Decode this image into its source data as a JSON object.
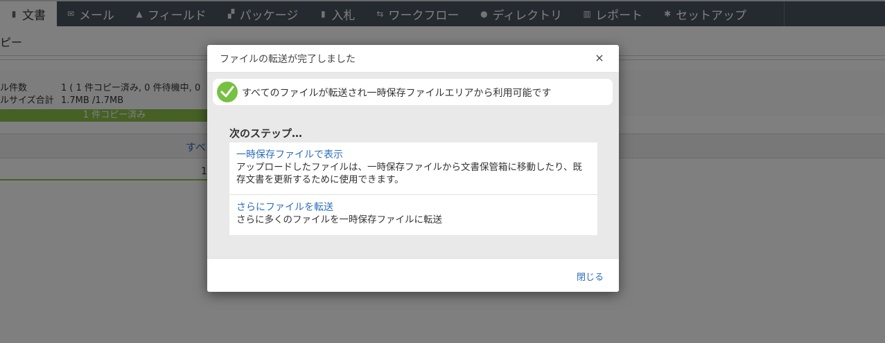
{
  "nav": {
    "items": [
      {
        "label": "文書",
        "icon": "document-icon",
        "glyph": "▮",
        "active": true
      },
      {
        "label": "メール",
        "icon": "envelope-icon",
        "glyph": "✉",
        "active": false
      },
      {
        "label": "フィールド",
        "icon": "warning-icon",
        "glyph": "▲",
        "active": false
      },
      {
        "label": "パッケージ",
        "icon": "package-icon",
        "glyph": "▞",
        "active": false
      },
      {
        "label": "入札",
        "icon": "file-icon",
        "glyph": "▮",
        "active": false
      },
      {
        "label": "ワークフロー",
        "icon": "workflow-icon",
        "glyph": "⇆",
        "active": false
      },
      {
        "label": "ディレクトリ",
        "icon": "users-icon",
        "glyph": "●",
        "active": false
      },
      {
        "label": "レポート",
        "icon": "bar-chart-icon",
        "glyph": "▥",
        "active": false
      },
      {
        "label": "セットアップ",
        "icon": "gear-icon",
        "glyph": "✱",
        "active": false
      }
    ]
  },
  "background": {
    "heading": "ピー",
    "file_count_label": "ル件数",
    "file_count_value": "1 ( 1 件コピー済み, 0 件待機中, 0",
    "file_size_label": "ルサイズ合計",
    "file_size_value": "1.7MB /1.7MB",
    "progress_text": "1 件コピー済み",
    "progress_value": 1.0,
    "tab_partial": "すべ",
    "page_number": "1"
  },
  "modal": {
    "title": "ファイルの転送が完了しました",
    "close_glyph": "×",
    "alert_text": "すべてのファイルが転送され一時保存ファイルエリアから利用可能です",
    "next_steps_title": "次のステップ…",
    "steps": [
      {
        "link": "一時保存ファイルで表示",
        "description": "アップロードしたファイルは、一時保存ファイルから文書保管箱に移動したり、既存文書を更新するために使用できます。"
      },
      {
        "link": "さらにファイルを転送",
        "description": "さらに多くのファイルを一時保存ファイルに転送"
      }
    ],
    "footer_close": "閉じる"
  },
  "colors": {
    "nav_bg": "#4a5561",
    "success_green": "#76c043",
    "link_blue": "#2a6ebb",
    "progress_green": "#8cc14c"
  }
}
